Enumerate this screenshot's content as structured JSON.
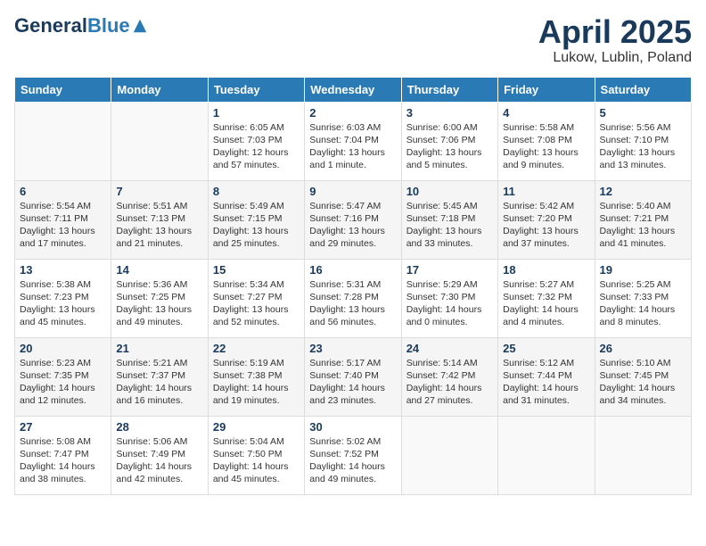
{
  "header": {
    "logo_general": "General",
    "logo_blue": "Blue",
    "month_title": "April 2025",
    "location": "Lukow, Lublin, Poland"
  },
  "days_of_week": [
    "Sunday",
    "Monday",
    "Tuesday",
    "Wednesday",
    "Thursday",
    "Friday",
    "Saturday"
  ],
  "weeks": [
    [
      {
        "day": "",
        "content": ""
      },
      {
        "day": "",
        "content": ""
      },
      {
        "day": "1",
        "content": "Sunrise: 6:05 AM\nSunset: 7:03 PM\nDaylight: 12 hours and 57 minutes."
      },
      {
        "day": "2",
        "content": "Sunrise: 6:03 AM\nSunset: 7:04 PM\nDaylight: 13 hours and 1 minute."
      },
      {
        "day": "3",
        "content": "Sunrise: 6:00 AM\nSunset: 7:06 PM\nDaylight: 13 hours and 5 minutes."
      },
      {
        "day": "4",
        "content": "Sunrise: 5:58 AM\nSunset: 7:08 PM\nDaylight: 13 hours and 9 minutes."
      },
      {
        "day": "5",
        "content": "Sunrise: 5:56 AM\nSunset: 7:10 PM\nDaylight: 13 hours and 13 minutes."
      }
    ],
    [
      {
        "day": "6",
        "content": "Sunrise: 5:54 AM\nSunset: 7:11 PM\nDaylight: 13 hours and 17 minutes."
      },
      {
        "day": "7",
        "content": "Sunrise: 5:51 AM\nSunset: 7:13 PM\nDaylight: 13 hours and 21 minutes."
      },
      {
        "day": "8",
        "content": "Sunrise: 5:49 AM\nSunset: 7:15 PM\nDaylight: 13 hours and 25 minutes."
      },
      {
        "day": "9",
        "content": "Sunrise: 5:47 AM\nSunset: 7:16 PM\nDaylight: 13 hours and 29 minutes."
      },
      {
        "day": "10",
        "content": "Sunrise: 5:45 AM\nSunset: 7:18 PM\nDaylight: 13 hours and 33 minutes."
      },
      {
        "day": "11",
        "content": "Sunrise: 5:42 AM\nSunset: 7:20 PM\nDaylight: 13 hours and 37 minutes."
      },
      {
        "day": "12",
        "content": "Sunrise: 5:40 AM\nSunset: 7:21 PM\nDaylight: 13 hours and 41 minutes."
      }
    ],
    [
      {
        "day": "13",
        "content": "Sunrise: 5:38 AM\nSunset: 7:23 PM\nDaylight: 13 hours and 45 minutes."
      },
      {
        "day": "14",
        "content": "Sunrise: 5:36 AM\nSunset: 7:25 PM\nDaylight: 13 hours and 49 minutes."
      },
      {
        "day": "15",
        "content": "Sunrise: 5:34 AM\nSunset: 7:27 PM\nDaylight: 13 hours and 52 minutes."
      },
      {
        "day": "16",
        "content": "Sunrise: 5:31 AM\nSunset: 7:28 PM\nDaylight: 13 hours and 56 minutes."
      },
      {
        "day": "17",
        "content": "Sunrise: 5:29 AM\nSunset: 7:30 PM\nDaylight: 14 hours and 0 minutes."
      },
      {
        "day": "18",
        "content": "Sunrise: 5:27 AM\nSunset: 7:32 PM\nDaylight: 14 hours and 4 minutes."
      },
      {
        "day": "19",
        "content": "Sunrise: 5:25 AM\nSunset: 7:33 PM\nDaylight: 14 hours and 8 minutes."
      }
    ],
    [
      {
        "day": "20",
        "content": "Sunrise: 5:23 AM\nSunset: 7:35 PM\nDaylight: 14 hours and 12 minutes."
      },
      {
        "day": "21",
        "content": "Sunrise: 5:21 AM\nSunset: 7:37 PM\nDaylight: 14 hours and 16 minutes."
      },
      {
        "day": "22",
        "content": "Sunrise: 5:19 AM\nSunset: 7:38 PM\nDaylight: 14 hours and 19 minutes."
      },
      {
        "day": "23",
        "content": "Sunrise: 5:17 AM\nSunset: 7:40 PM\nDaylight: 14 hours and 23 minutes."
      },
      {
        "day": "24",
        "content": "Sunrise: 5:14 AM\nSunset: 7:42 PM\nDaylight: 14 hours and 27 minutes."
      },
      {
        "day": "25",
        "content": "Sunrise: 5:12 AM\nSunset: 7:44 PM\nDaylight: 14 hours and 31 minutes."
      },
      {
        "day": "26",
        "content": "Sunrise: 5:10 AM\nSunset: 7:45 PM\nDaylight: 14 hours and 34 minutes."
      }
    ],
    [
      {
        "day": "27",
        "content": "Sunrise: 5:08 AM\nSunset: 7:47 PM\nDaylight: 14 hours and 38 minutes."
      },
      {
        "day": "28",
        "content": "Sunrise: 5:06 AM\nSunset: 7:49 PM\nDaylight: 14 hours and 42 minutes."
      },
      {
        "day": "29",
        "content": "Sunrise: 5:04 AM\nSunset: 7:50 PM\nDaylight: 14 hours and 45 minutes."
      },
      {
        "day": "30",
        "content": "Sunrise: 5:02 AM\nSunset: 7:52 PM\nDaylight: 14 hours and 49 minutes."
      },
      {
        "day": "",
        "content": ""
      },
      {
        "day": "",
        "content": ""
      },
      {
        "day": "",
        "content": ""
      }
    ]
  ]
}
